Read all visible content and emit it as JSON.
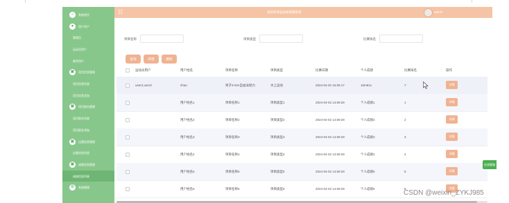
{
  "sidebar": {
    "items": [
      {
        "label": "系统首页",
        "icon": "home-icon",
        "kind": "top"
      },
      {
        "label": "用户用户",
        "icon": "user-icon",
        "kind": "top"
      },
      {
        "label": "管理员",
        "kind": "sub"
      },
      {
        "label": "运动员用户",
        "kind": "sub"
      },
      {
        "label": "裁判用户",
        "kind": "sub"
      },
      {
        "label": "项目信息管理",
        "icon": "folder-icon",
        "kind": "top"
      },
      {
        "label": "项目信息列表",
        "kind": "sub"
      },
      {
        "label": "项目信息添加",
        "kind": "sub"
      },
      {
        "label": "项目报名管理",
        "icon": "folder-icon",
        "kind": "top"
      },
      {
        "label": "项目报名列表",
        "kind": "sub"
      },
      {
        "label": "项目报名添加",
        "kind": "sub"
      },
      {
        "label": "比赛信息管理",
        "icon": "folder-icon",
        "kind": "top"
      },
      {
        "label": "比赛信息列表",
        "kind": "sub"
      },
      {
        "label": "成绩信息管理",
        "icon": "folder-icon",
        "kind": "top"
      },
      {
        "label": "成绩信息列表",
        "kind": "sub",
        "active": true
      },
      {
        "label": "系统管理",
        "icon": "gear-icon",
        "kind": "top"
      }
    ]
  },
  "topbar": {
    "title": "高校体育运动会管理系统",
    "user": "admin"
  },
  "search": {
    "project_name_label": "项目名称",
    "project_type_label": "项目类型",
    "rank_label": "比赛排名",
    "buttons": [
      "查询",
      "新增",
      "删除"
    ]
  },
  "table": {
    "headers": [
      "运动员用户",
      "用户姓名",
      "项目名称",
      "项目类型",
      "比赛日期",
      "个人成绩",
      "比赛排名",
      "操作"
    ],
    "action_label": "详情",
    "rows": [
      [
        "user2,user3",
        "zhao",
        "男子4×5m自由泳接力",
        "水上运动",
        "2024-04-02 15:06:17",
        "15m91s",
        "7"
      ],
      [
        "",
        "用户姓名1",
        "项目名称1",
        "项目类型1",
        "2024-04-02 14:59:29",
        "个人成绩1",
        "1"
      ],
      [
        "",
        "用户姓名2",
        "项目名称2",
        "项目类型2",
        "2024-04-02 14:59:29",
        "个人成绩2",
        "2"
      ],
      [
        "",
        "用户姓名3",
        "项目名称3",
        "项目类型3",
        "2024-04-02 14:59:29",
        "个人成绩3",
        "3"
      ],
      [
        "",
        "用户姓名4",
        "项目名称4",
        "项目类型4",
        "2024-04-02 14:59:29",
        "个人成绩4",
        "4"
      ],
      [
        "",
        "用户姓名5",
        "项目名称5",
        "项目类型5",
        "2024-04-02 14:59:29",
        "个人成绩5",
        "5"
      ],
      [
        "",
        "用户姓名6",
        "项目名称6",
        "项目类型6",
        "2024-04-02 14:59:29",
        "个人成绩6",
        "6"
      ]
    ]
  },
  "float_tab": "在线客服",
  "watermark": "CSDN @weixin_ZYKJ985",
  "colors": {
    "sidebar": "#88c78b",
    "topbar": "#f5c4a6",
    "button": "#f0b392"
  }
}
